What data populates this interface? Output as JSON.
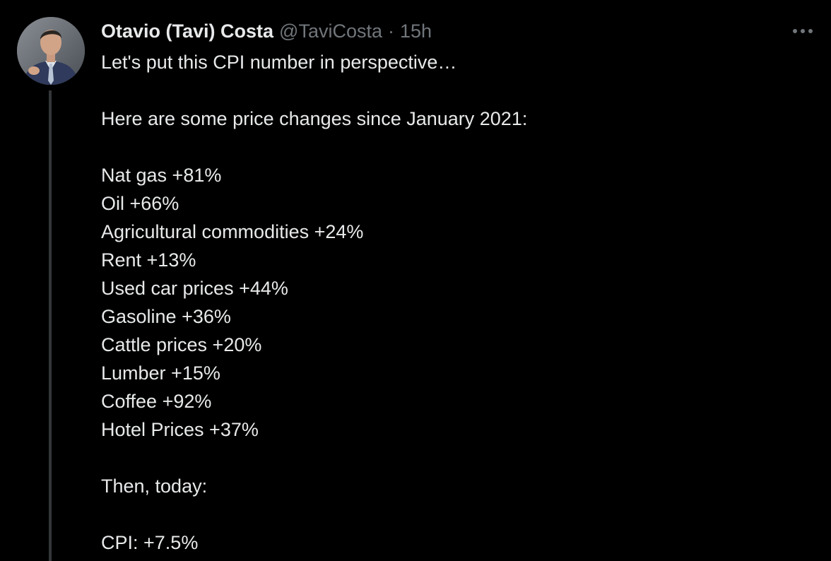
{
  "tweet": {
    "author": {
      "display_name": "Otavio (Tavi) Costa",
      "handle": "@TaviCosta",
      "avatar_icon": "profile-photo"
    },
    "separator": "·",
    "time_ago": "15h",
    "more_icon": "more-horizontal-icon",
    "lines": [
      "Let's put this CPI number in perspective…",
      "",
      "Here are some price changes since January 2021:",
      "",
      "Nat gas +81%",
      "Oil +66%",
      "Agricultural commodities +24%",
      "Rent +13%",
      "Used car prices +44%",
      "Gasoline +36%",
      "Cattle prices +20%",
      "Lumber +15%",
      "Coffee +92%",
      "Hotel Prices +37%",
      "",
      "Then, today:",
      "",
      "CPI: +7.5%"
    ]
  },
  "colors": {
    "background": "#000000",
    "primary_text": "#e7e9ea",
    "secondary_text": "#71767b",
    "thread_line": "#333639"
  }
}
